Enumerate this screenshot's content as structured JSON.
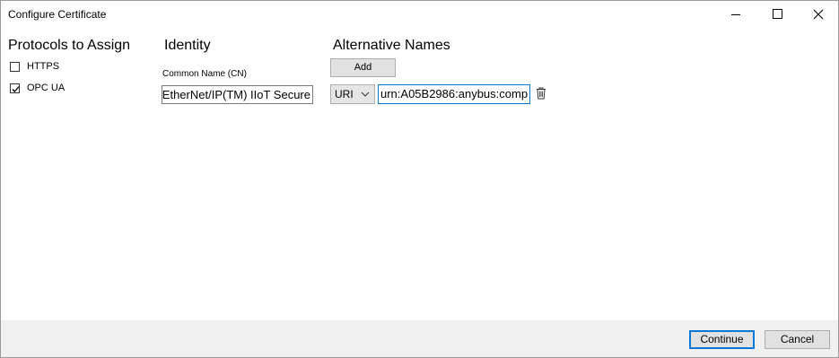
{
  "window": {
    "title": "Configure Certificate"
  },
  "protocols": {
    "heading": "Protocols to Assign",
    "items": [
      {
        "label": "HTTPS",
        "checked": false
      },
      {
        "label": "OPC UA",
        "checked": true
      }
    ]
  },
  "identity": {
    "heading": "Identity",
    "common_name_label": "Common Name (CN)",
    "common_name_value": "EtherNet/IP(TM) IIoT Secure"
  },
  "alternative_names": {
    "heading": "Alternative Names",
    "add_label": "Add",
    "type_value": "URI",
    "uri_value": "urn:A05B2986:anybus:comp"
  },
  "footer": {
    "continue_label": "Continue",
    "cancel_label": "Cancel"
  },
  "icons": {
    "check": "check-icon",
    "dropdown": "chevron-down-icon",
    "delete": "trash-icon"
  }
}
